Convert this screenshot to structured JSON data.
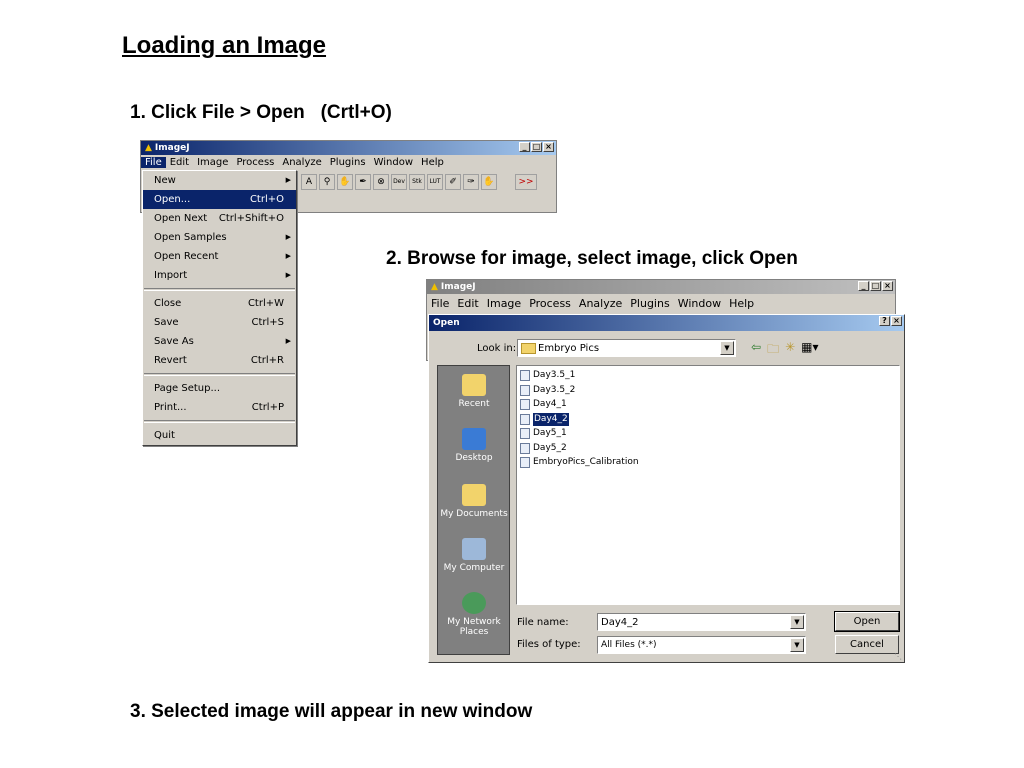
{
  "slide": {
    "title": "Loading an Image",
    "step1": "1. Click File > Open   (Crtl+O)",
    "step2": "2. Browse for image, select image, click Open",
    "step3": "3. Selected image will appear in new window"
  },
  "imagej_window": {
    "title": "ImageJ",
    "menus": [
      "File",
      "Edit",
      "Image",
      "Process",
      "Analyze",
      "Plugins",
      "Window",
      "Help"
    ],
    "tools": [
      "A",
      "⚲",
      "✋",
      "✒",
      "⊗",
      "Dev",
      "Stk",
      "LUT",
      "✐",
      "✑",
      "✋",
      ">>"
    ]
  },
  "file_menu": {
    "items": [
      {
        "label": "New",
        "shortcut": "",
        "submenu": true
      },
      {
        "label": "Open...",
        "shortcut": "Ctrl+O",
        "submenu": false,
        "highlighted": true
      },
      {
        "label": "Open Next",
        "shortcut": "Ctrl+Shift+O",
        "submenu": false
      },
      {
        "label": "Open Samples",
        "shortcut": "",
        "submenu": true
      },
      {
        "label": "Open Recent",
        "shortcut": "",
        "submenu": true
      },
      {
        "label": "Import",
        "shortcut": "",
        "submenu": true
      },
      {
        "label": "Close",
        "shortcut": "Ctrl+W",
        "submenu": false
      },
      {
        "label": "Save",
        "shortcut": "Ctrl+S",
        "submenu": false
      },
      {
        "label": "Save As",
        "shortcut": "",
        "submenu": true
      },
      {
        "label": "Revert",
        "shortcut": "Ctrl+R",
        "submenu": false
      },
      {
        "label": "Page Setup...",
        "shortcut": "",
        "submenu": false
      },
      {
        "label": "Print...",
        "shortcut": "Ctrl+P",
        "submenu": false
      },
      {
        "label": "Quit",
        "shortcut": "",
        "submenu": false
      }
    ]
  },
  "imagej_window2": {
    "title": "ImageJ",
    "menus": [
      "File",
      "Edit",
      "Image",
      "Process",
      "Analyze",
      "Plugins",
      "Window",
      "Help"
    ]
  },
  "open_dialog": {
    "title": "Open",
    "help_btn": "?",
    "close_btn": "×",
    "look_in_label": "Look in:",
    "look_in_value": "Embryo Pics",
    "places": [
      "Recent",
      "Desktop",
      "My Documents",
      "My Computer",
      "My Network Places"
    ],
    "files": [
      {
        "name": "Day3.5_1",
        "selected": false
      },
      {
        "name": "Day3.5_2",
        "selected": false
      },
      {
        "name": "Day4_1",
        "selected": false
      },
      {
        "name": "Day4_2",
        "selected": true
      },
      {
        "name": "Day5_1",
        "selected": false
      },
      {
        "name": "Day5_2",
        "selected": false
      },
      {
        "name": "EmbryoPics_Calibration",
        "selected": false
      }
    ],
    "file_name_label": "File name:",
    "file_name_value": "Day4_2",
    "file_type_label": "Files of type:",
    "file_type_value": "All Files (*.*)",
    "open_btn": "Open",
    "cancel_btn": "Cancel"
  },
  "colors": {
    "title_active": "#0a246a",
    "dialog_bg": "#d4d0c8",
    "places_bg": "#808080"
  }
}
